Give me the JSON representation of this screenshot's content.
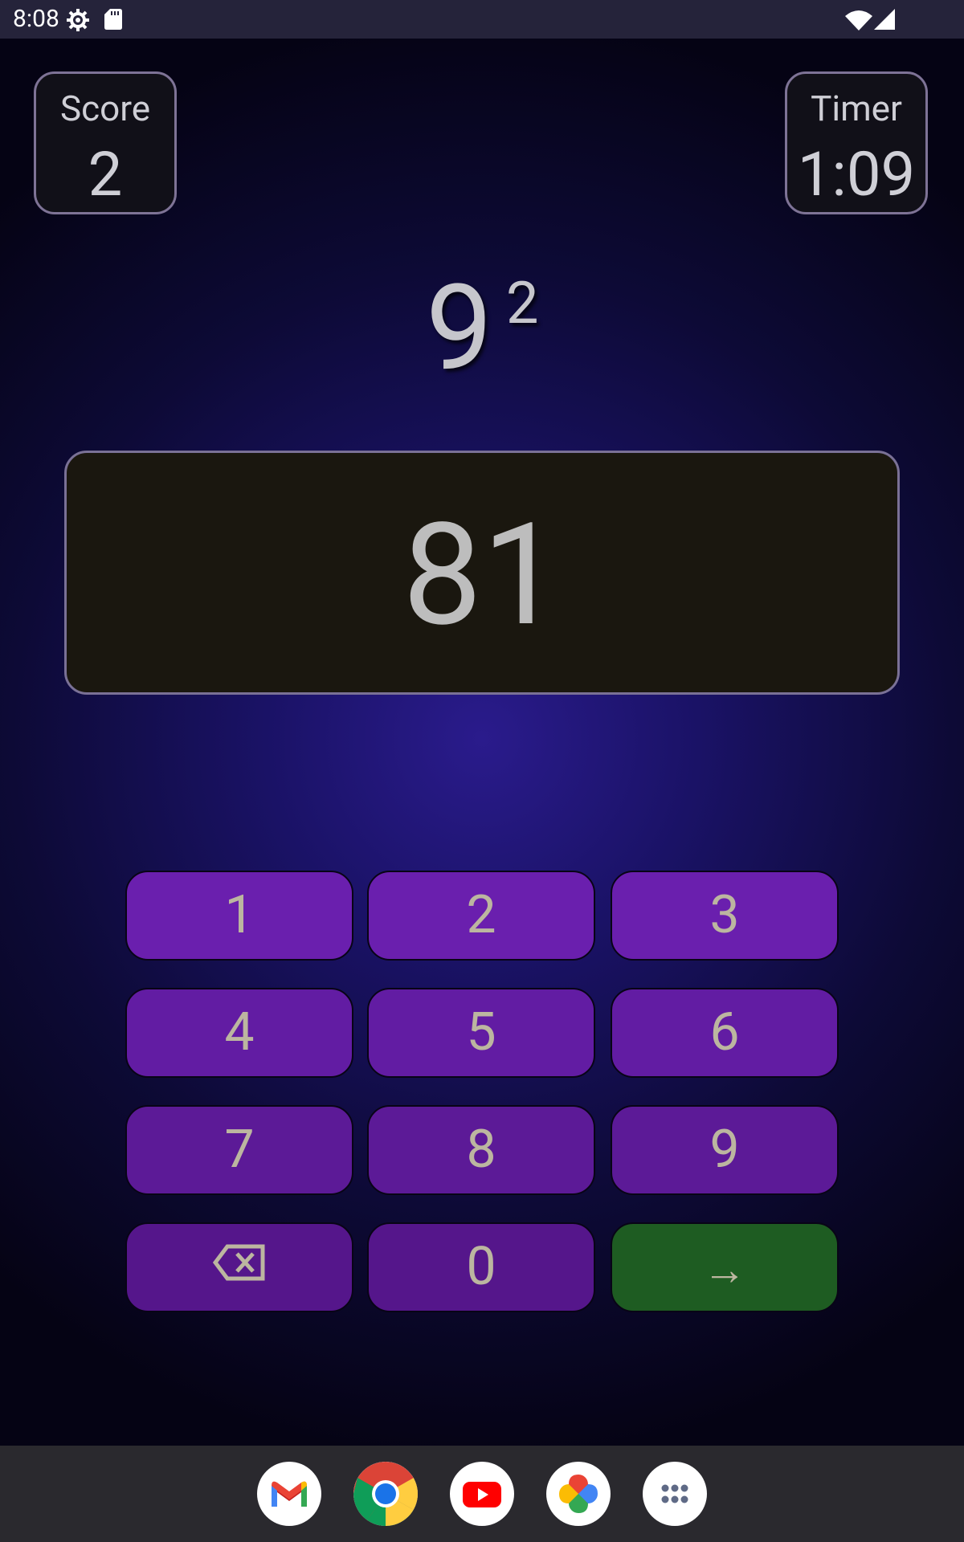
{
  "status_bar": {
    "time": "8:08",
    "icons": [
      "settings-gear-icon",
      "sd-card-icon",
      "wifi-icon",
      "cell-signal-icon"
    ]
  },
  "score": {
    "label": "Score",
    "value": "2"
  },
  "timer": {
    "label": "Timer",
    "value": "1:09"
  },
  "question": {
    "base": "9",
    "exponent": "2"
  },
  "answer": {
    "value": "81"
  },
  "keypad": {
    "keys": [
      "1",
      "2",
      "3",
      "4",
      "5",
      "6",
      "7",
      "8",
      "9",
      "0"
    ],
    "backspace_icon": "backspace-icon",
    "enter_icon": "arrow-right-icon",
    "enter_label": "→"
  },
  "colors": {
    "key_purple": "#6a1fae",
    "enter_green": "#1e5c22",
    "answer_bg": "#1a170f",
    "text_tan": "#bcb6a0"
  },
  "dock": {
    "apps": [
      "Gmail",
      "Chrome",
      "YouTube",
      "Photos",
      "App drawer"
    ],
    "icons": [
      "gmail-icon",
      "chrome-icon",
      "youtube-icon",
      "photos-icon",
      "app-drawer-icon"
    ]
  }
}
